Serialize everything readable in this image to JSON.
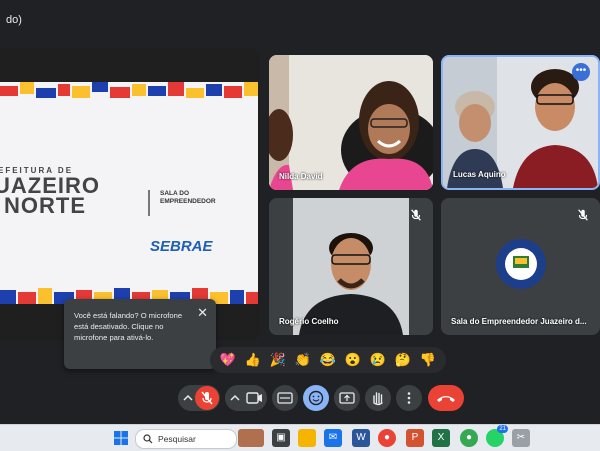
{
  "window": {
    "title_fragment": "do)"
  },
  "presentation": {
    "slide_small": "EFEITURA DE",
    "slide_line1": "UAZEIRO",
    "slide_line2": "NORTE",
    "sala_line1": "SALA DO",
    "sala_line2": "EMPREENDEDOR",
    "sebrae": "SEBRAE"
  },
  "participants": [
    {
      "name": "Nilda David"
    },
    {
      "name": "Lucas Aquino"
    },
    {
      "name": "Rogério Coelho"
    },
    {
      "name": "Sala do Empreendedor Juazeiro d..."
    }
  ],
  "popup": {
    "message": "Você está falando? O microfone está desativado. Clique no microfone para ativá-lo.",
    "close_glyph": "✕"
  },
  "reactions": [
    "💖",
    "👍",
    "🎉",
    "👏",
    "😂",
    "😮",
    "😢",
    "🤔",
    "👎"
  ],
  "taskbar": {
    "search_placeholder": "Pesquisar",
    "whatsapp_badge": "21"
  },
  "colors": {
    "meet_bg": "#202124",
    "tile_bg": "#3c4043",
    "hangup_red": "#ea4335",
    "active_speaker": "#8ab4f8",
    "sebrae_blue": "#1f5fb5"
  },
  "icons": [
    "mic-off-icon",
    "camera-icon",
    "captions-icon",
    "emoji-icon",
    "present-icon",
    "raise-hand-icon",
    "more-icon",
    "hangup-icon",
    "windows-start-icon",
    "search-icon"
  ]
}
